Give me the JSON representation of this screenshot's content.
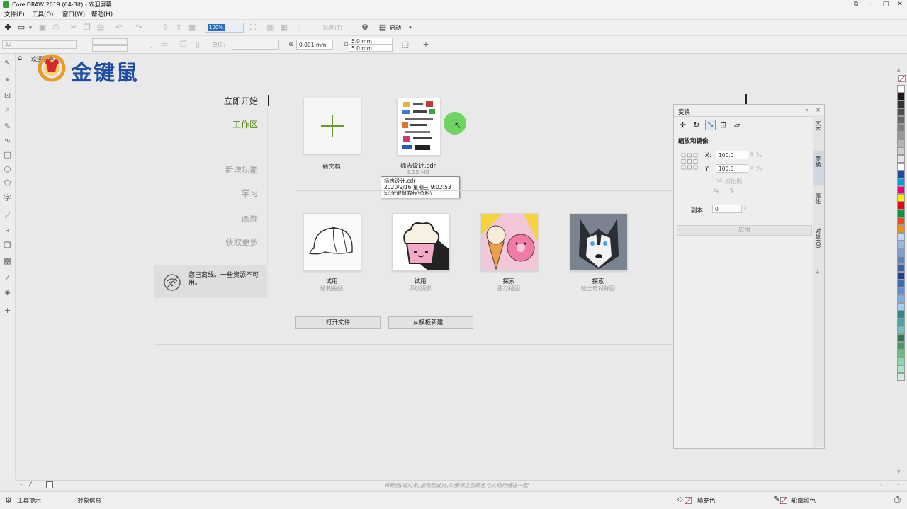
{
  "window": {
    "title": "CorelDRAW 2019 (64-Bit) - 欢迎屏幕",
    "controls": [
      "⧉",
      "–",
      "□",
      "✕"
    ]
  },
  "menu": [
    "文件(F)",
    "工具(O)",
    "窗口(W)",
    "帮助(H)"
  ],
  "toolbar1": {
    "zoom_value": "100%",
    "snap_label": "贴齐(T)",
    "launch_label": "启动"
  },
  "toolbar2": {
    "page_size": "A4",
    "unit_label": "单位:",
    "nudge": "0.001 mm",
    "dup_x": "5.0 mm",
    "dup_y": "5.0 mm"
  },
  "tab": {
    "label": "欢迎屏幕"
  },
  "logo": {
    "text": "金键鼠"
  },
  "welcome": {
    "nav": [
      {
        "label": "立即开始",
        "state": "current"
      },
      {
        "label": "工作区",
        "state": "active"
      },
      {
        "label": "新增功能",
        "state": "muted"
      },
      {
        "label": "学习",
        "state": "muted"
      },
      {
        "label": "画廊",
        "state": "muted"
      },
      {
        "label": "获取更多",
        "state": "muted"
      }
    ],
    "offline_message": "您已离线。一些资源不可用。",
    "new_doc_label": "新文档",
    "recent_file": {
      "name": "标志设计.cdr",
      "size": "3.15 MB",
      "tooltip": [
        "标志设计.cdr",
        "2020/9/16 星期三  9:02:53",
        "E:\\金键鼠教程\\资料\\"
      ]
    },
    "templates": [
      {
        "title": "试用",
        "subtitle": "绘制曲线",
        "icon": "cap-icon"
      },
      {
        "title": "试用",
        "subtitle": "添加阴影",
        "icon": "cupcake-icon"
      },
      {
        "title": "探索",
        "subtitle": "甜心插图",
        "icon": "icecream-donut-icon"
      },
      {
        "title": "探索",
        "subtitle": "哈士奇对称图",
        "icon": "husky-icon"
      }
    ],
    "open_file_button": "打开文件",
    "from_template_button": "从模板新建..."
  },
  "docker": {
    "title": "变换",
    "section": "缩放和镜像",
    "x_label": "X:",
    "x_value": "100.0",
    "y_label": "Y:",
    "y_value": "100.0",
    "percent": "%",
    "proportional_label": "按比例",
    "copies_label": "副本:",
    "copies_value": "0",
    "apply_button": "应用",
    "side_tabs": [
      "文本",
      "变换",
      "属性",
      "对象(O)"
    ]
  },
  "palette_colors": [
    "#ffffff",
    "#1a1a1a",
    "#333333",
    "#4d4d4d",
    "#666666",
    "#808080",
    "#999999",
    "#b3b3b3",
    "#cccccc",
    "#e6e6e6",
    "#ffffff",
    "#1f4e9c",
    "#00a0e0",
    "#e6007e",
    "#ffef00",
    "#e30613",
    "#009640",
    "#e94e1b",
    "#f39200",
    "#c0d7ee",
    "#9bb8df",
    "#7e9fd1",
    "#5f7fbf",
    "#415faa",
    "#253f8f",
    "#3a6dbf",
    "#5b8fd1",
    "#7db1e3",
    "#a0d1f2",
    "#2e8b8b",
    "#4aa6a6",
    "#6fc1c1",
    "#2a7a4a",
    "#4a9a6a",
    "#6aba8a",
    "#8ad8aa",
    "#aae8c8",
    "#cfeedd"
  ],
  "status": {
    "drag_hint": "将颜色(或对象)拖动至此处,以便将这些颜色与文档存储在一起",
    "hints": "工具提示",
    "object_info": "对象信息",
    "fill_label": "填充色",
    "outline_label": "轮廓颜色"
  }
}
